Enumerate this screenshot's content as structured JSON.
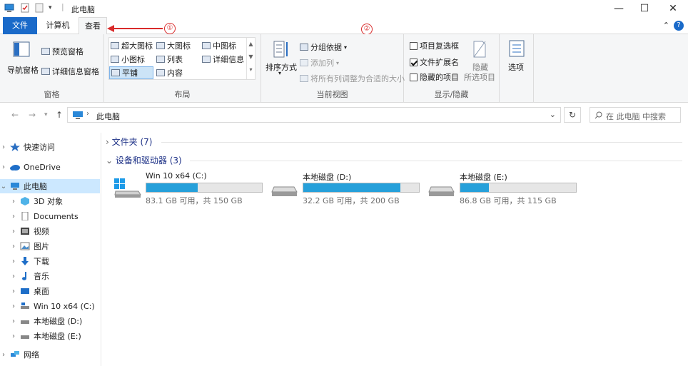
{
  "window": {
    "title": "此电脑",
    "controls": [
      "minimize-icon",
      "maximize-icon",
      "close-icon"
    ]
  },
  "tabs": [
    {
      "label": "文件"
    },
    {
      "label": "计算机"
    },
    {
      "label": "查看"
    }
  ],
  "ribbon": {
    "panes": {
      "label": "窗格",
      "nav_pane": "导航窗格",
      "preview_pane": "预览窗格",
      "details_pane": "详细信息窗格"
    },
    "layout": {
      "label": "布局",
      "options": [
        "超大图标",
        "大图标",
        "中图标",
        "小图标",
        "列表",
        "详细信息",
        "平铺",
        "内容"
      ],
      "selected": "平铺"
    },
    "current_view": {
      "label": "当前视图",
      "sort_by": "排序方式",
      "group_by": "分组依据",
      "add_columns": "添加列",
      "size_all_columns": "将所有列调整为合适的大小"
    },
    "show_hide": {
      "label": "显示/隐藏",
      "item_checkboxes": {
        "label": "项目复选框",
        "checked": false
      },
      "file_extensions": {
        "label": "文件扩展名",
        "checked": true
      },
      "hidden_items": {
        "label": "隐藏的项目",
        "checked": false
      },
      "hide_selected_line1": "隐藏",
      "hide_selected_line2": "所选项目"
    },
    "options": "选项"
  },
  "annotations": [
    "①",
    "②"
  ],
  "address": {
    "path": "此电脑",
    "search_placeholder": "在 此电脑 中搜索"
  },
  "sidebar": {
    "items": [
      {
        "label": "快速访问"
      },
      {
        "label": "OneDrive"
      },
      {
        "label": "此电脑"
      },
      {
        "label": "3D 对象"
      },
      {
        "label": "Documents"
      },
      {
        "label": "视频"
      },
      {
        "label": "图片"
      },
      {
        "label": "下载"
      },
      {
        "label": "音乐"
      },
      {
        "label": "桌面"
      },
      {
        "label": "Win 10 x64 (C:)"
      },
      {
        "label": "本地磁盘 (D:)"
      },
      {
        "label": "本地磁盘 (E:)"
      },
      {
        "label": "网络"
      }
    ]
  },
  "content": {
    "folders_header": "文件夹 (7)",
    "devices_header": "设备和驱动器 (3)",
    "drives": [
      {
        "name": "Win 10 x64 (C:)",
        "info": "83.1 GB 可用，共 150 GB",
        "used_fraction": 0.446
      },
      {
        "name": "本地磁盘 (D:)",
        "info": "32.2 GB 可用，共 200 GB",
        "used_fraction": 0.839
      },
      {
        "name": "本地磁盘 (E:)",
        "info": "86.8 GB 可用，共 115 GB",
        "used_fraction": 0.245
      }
    ]
  },
  "colors": {
    "accent": "#1a6ac9",
    "drive_fill": "#26a0da",
    "annotation": "#d92b2b"
  }
}
